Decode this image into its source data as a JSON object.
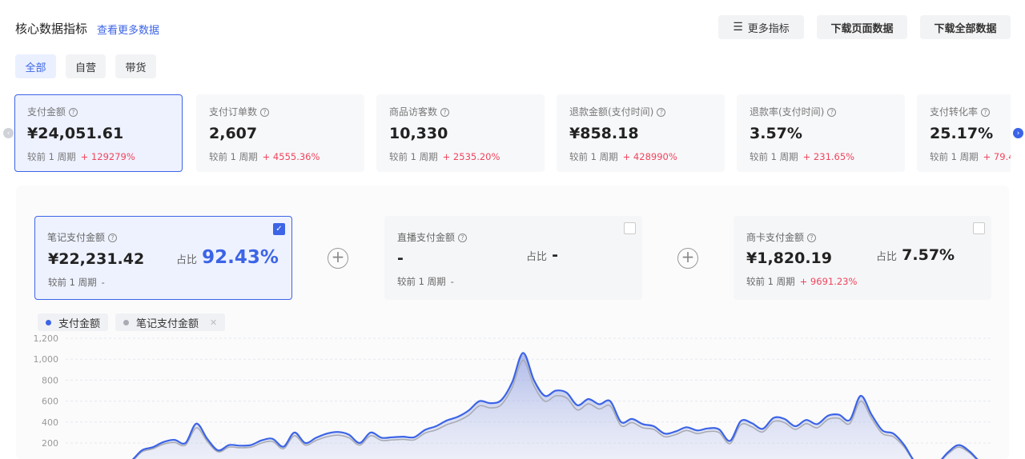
{
  "header": {
    "title": "核心数据指标",
    "more_link": "查看更多数据",
    "more_metrics_label": "更多指标",
    "download_page_label": "下载页面数据",
    "download_all_label": "下载全部数据"
  },
  "filter_tabs": [
    {
      "label": "全部",
      "active": true
    },
    {
      "label": "自营",
      "active": false
    },
    {
      "label": "带货",
      "active": false
    }
  ],
  "metric_cards": [
    {
      "label": "支付金额",
      "value": "¥24,051.61",
      "compare_label": "较前 1 周期",
      "change": "+ 129279%",
      "active": true
    },
    {
      "label": "支付订单数",
      "value": "2,607",
      "compare_label": "较前 1 周期",
      "change": "+ 4555.36%",
      "active": false
    },
    {
      "label": "商品访客数",
      "value": "10,330",
      "compare_label": "较前 1 周期",
      "change": "+ 2535.20%",
      "active": false
    },
    {
      "label": "退款金额(支付时间)",
      "value": "¥858.18",
      "compare_label": "较前 1 周期",
      "change": "+ 428990%",
      "active": false
    },
    {
      "label": "退款率(支付时间)",
      "value": "3.57%",
      "compare_label": "较前 1 周期",
      "change": "+ 231.65%",
      "active": false
    },
    {
      "label": "支付转化率",
      "value": "25.17%",
      "compare_label": "较前 1 周期",
      "change": "+ 79.4",
      "active": false
    }
  ],
  "detail_cards": [
    {
      "label": "笔记支付金额",
      "value": "¥22,231.42",
      "share_label": "占比",
      "share": "92.43%",
      "compare_label": "较前 1 周期",
      "change": "-",
      "checked": true
    },
    {
      "label": "直播支付金额",
      "value": "-",
      "share_label": "占比",
      "share": "-",
      "compare_label": "较前 1 周期",
      "change": "-",
      "checked": false
    },
    {
      "label": "商卡支付金额",
      "value": "¥1,820.19",
      "share_label": "占比",
      "share": "7.57%",
      "compare_label": "较前 1 周期",
      "change": "+ 9691.23%",
      "checked": false
    }
  ],
  "legend": [
    {
      "name": "支付金额",
      "color": "#3c64e6"
    },
    {
      "name": "笔记支付金额",
      "color": "#a9acb3"
    }
  ],
  "chart_data": {
    "type": "area",
    "y_ticks": [
      "1,200",
      "1,000",
      "800",
      "600",
      "400",
      "200"
    ],
    "ylim": [
      0,
      1200
    ],
    "series": [
      {
        "name": "支付金额",
        "color": "#3c64e6",
        "values": [
          0,
          0,
          0,
          0,
          0,
          0,
          30,
          130,
          160,
          210,
          230,
          200,
          385,
          240,
          130,
          180,
          175,
          180,
          225,
          240,
          165,
          300,
          200,
          250,
          290,
          305,
          280,
          200,
          300,
          250,
          255,
          260,
          255,
          325,
          360,
          415,
          450,
          510,
          600,
          580,
          610,
          780,
          1060,
          800,
          650,
          700,
          680,
          560,
          620,
          570,
          600,
          400,
          430,
          380,
          360,
          290,
          310,
          350,
          320,
          340,
          330,
          220,
          410,
          390,
          335,
          440,
          430,
          360,
          420,
          380,
          460,
          470,
          420,
          650,
          470,
          320,
          290,
          180,
          20,
          0,
          0,
          110,
          180,
          120,
          20,
          0
        ]
      },
      {
        "name": "笔记支付金额",
        "color": "#a9acb3",
        "values": [
          0,
          0,
          0,
          0,
          0,
          0,
          20,
          115,
          145,
          190,
          205,
          180,
          345,
          215,
          115,
          160,
          155,
          160,
          200,
          215,
          145,
          270,
          180,
          225,
          260,
          275,
          250,
          180,
          270,
          225,
          230,
          235,
          230,
          295,
          325,
          375,
          410,
          465,
          555,
          535,
          565,
          730,
          990,
          745,
          600,
          650,
          630,
          515,
          575,
          525,
          555,
          365,
          395,
          345,
          330,
          260,
          280,
          320,
          290,
          310,
          300,
          195,
          375,
          355,
          305,
          405,
          395,
          330,
          385,
          345,
          425,
          435,
          385,
          600,
          435,
          290,
          260,
          160,
          15,
          0,
          0,
          95,
          160,
          105,
          15,
          0
        ]
      }
    ]
  }
}
